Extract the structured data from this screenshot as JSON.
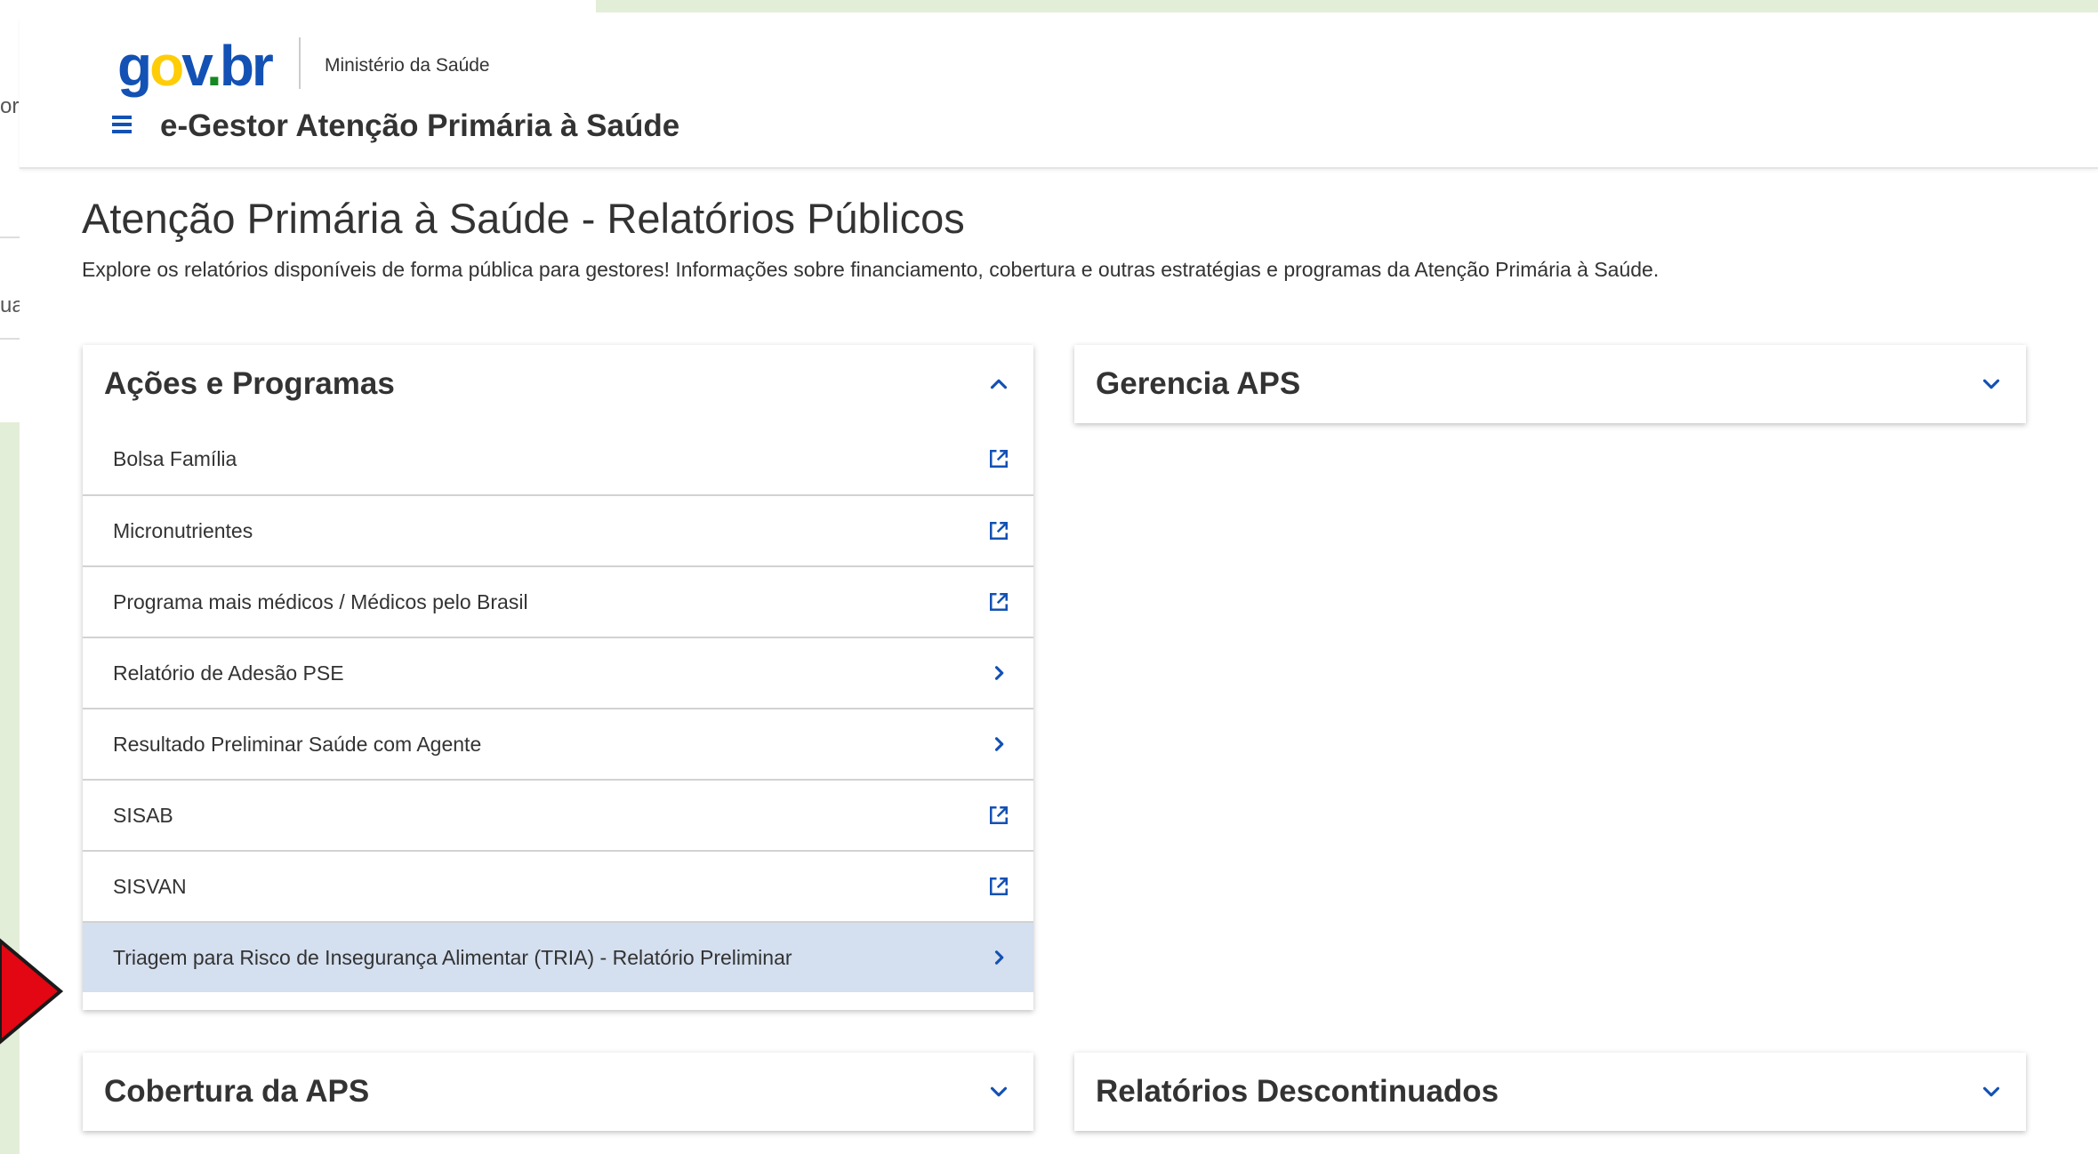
{
  "background": {
    "fragment_1": "orc",
    "fragment_2": "ua"
  },
  "header": {
    "logo": {
      "g1": "g",
      "g2": "o",
      "g3": "v",
      "dot": ".",
      "g4": "br"
    },
    "ministry": "Ministério da Saúde",
    "menu_icon": "hamburger-menu-icon",
    "system_title": "e-Gestor Atenção Primária à Saúde"
  },
  "page": {
    "title": "Atenção Primária à Saúde - Relatórios Públicos",
    "subtitle": "Explore os relatórios disponíveis de forma pública para gestores! Informações sobre financiamento, cobertura e outras estratégias e programas da Atenção Primária à Saúde."
  },
  "cards": {
    "acoes": {
      "title": "Ações e Programas",
      "expanded": true,
      "items": [
        {
          "label": "Bolsa Família",
          "icon": "external-link-icon"
        },
        {
          "label": "Micronutrientes",
          "icon": "external-link-icon"
        },
        {
          "label": "Programa mais médicos / Médicos pelo Brasil",
          "icon": "external-link-icon"
        },
        {
          "label": "Relatório de Adesão PSE",
          "icon": "chevron-right-icon"
        },
        {
          "label": "Resultado Preliminar Saúde com Agente",
          "icon": "chevron-right-icon"
        },
        {
          "label": "SISAB",
          "icon": "external-link-icon"
        },
        {
          "label": "SISVAN",
          "icon": "external-link-icon"
        },
        {
          "label": "Triagem para Risco de Insegurança Alimentar (TRIA) - Relatório Preliminar",
          "icon": "chevron-right-icon",
          "highlighted": true
        }
      ]
    },
    "gerencia": {
      "title": "Gerencia APS",
      "expanded": false
    },
    "cobertura": {
      "title": "Cobertura da APS",
      "expanded": false
    },
    "descontinuados": {
      "title": "Relatórios Descontinuados",
      "expanded": false
    }
  },
  "colors": {
    "primary_blue": "#1351b4",
    "highlight_row": "#d4dfef",
    "annotation_arrow": "#e30613",
    "background_green": "#e3eed9"
  }
}
